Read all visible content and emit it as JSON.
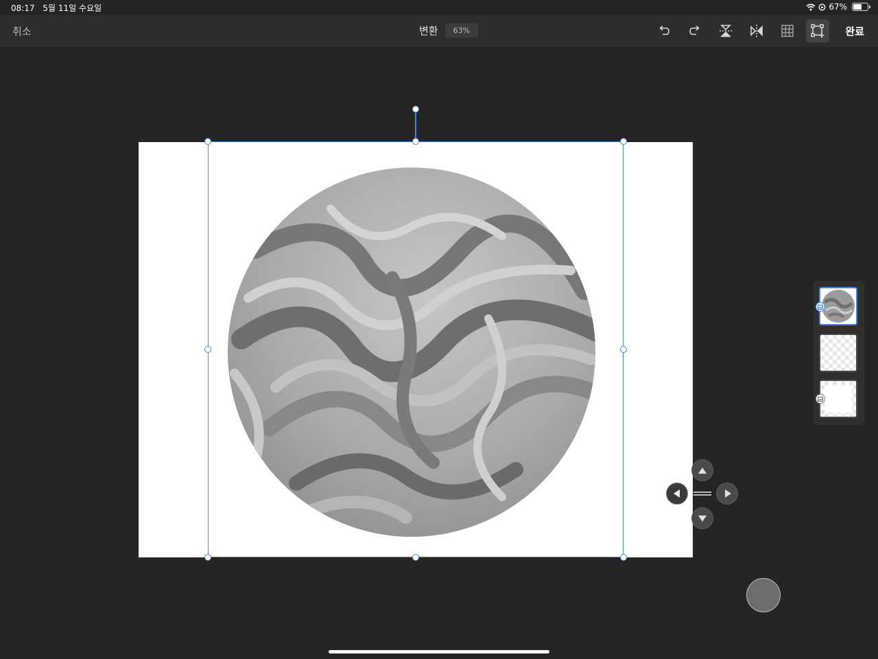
{
  "status_bar": {
    "time": "08:17",
    "date": "5월 11일 수요일",
    "battery_percent": "67%",
    "battery_level": 0.67,
    "icons": [
      "wifi-icon",
      "orientation-lock-icon",
      "battery-icon"
    ]
  },
  "toolbar": {
    "cancel_label": "취소",
    "title": "변환",
    "zoom_label": "63%",
    "done_label": "완료",
    "tools": [
      "undo-icon",
      "redo-icon",
      "flip-vertical-icon",
      "flip-horizontal-icon",
      "grid-icon",
      "free-transform-icon"
    ],
    "active_tool": "free-transform-icon"
  },
  "canvas": {
    "content": "marbled grayscale sphere",
    "selection_color": "#4a84d8"
  },
  "nudge_pad": {
    "icons": [
      "arrow-up-icon",
      "arrow-left-icon",
      "drag-handle-icon",
      "arrow-right-icon",
      "arrow-down-icon"
    ]
  },
  "layers": {
    "items": [
      "sphere-layer",
      "empty-layer",
      "background-layer"
    ],
    "selected_index": 0
  },
  "colors": {
    "background": "#252525",
    "toolbar": "#2d2d2d",
    "accent": "#4a84d8"
  }
}
